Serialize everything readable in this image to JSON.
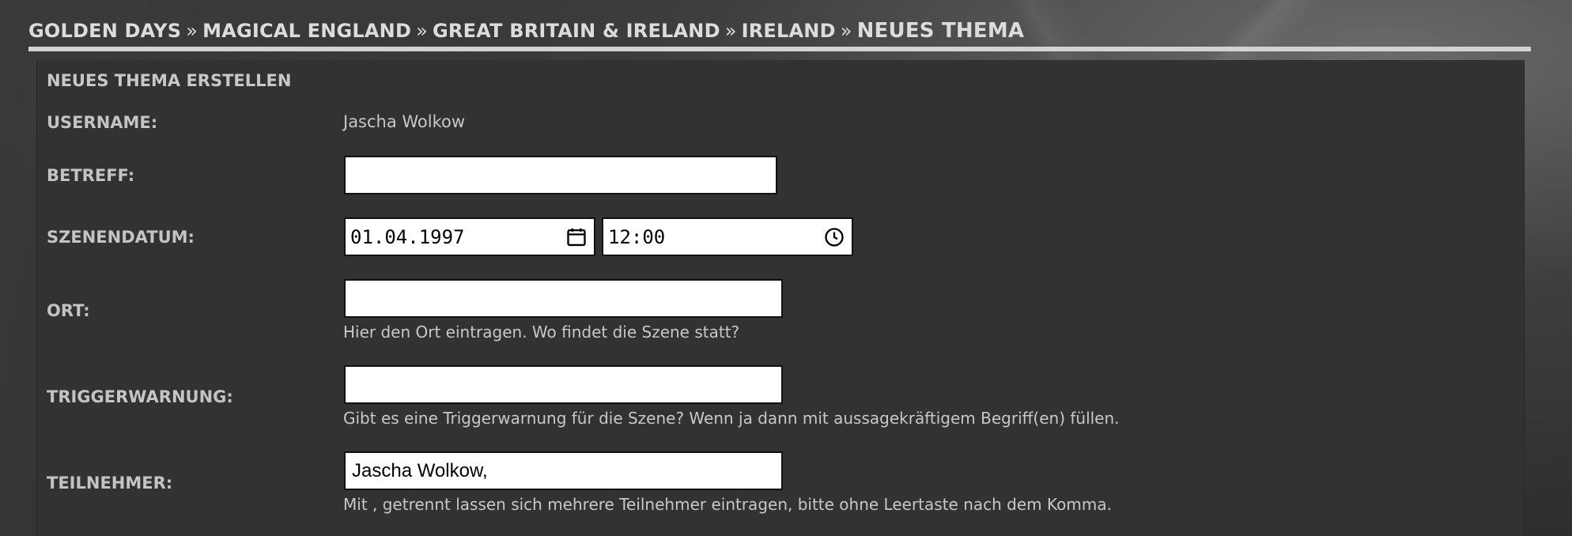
{
  "breadcrumb": {
    "items": [
      "GOLDEN DAYS",
      "MAGICAL ENGLAND",
      "GREAT BRITAIN & IRELAND",
      "IRELAND",
      "NEUES THEMA"
    ],
    "separator": "»"
  },
  "form": {
    "title": "NEUES THEMA ERSTELLEN",
    "username_label": "USERNAME:",
    "username_value": "Jascha Wolkow",
    "subject_label": "BETREFF:",
    "subject_value": "",
    "scene_date_label": "SZENENDATUM:",
    "scene_date_value": "01.04.1997",
    "scene_time_value": "12:00",
    "location_label": "ORT:",
    "location_value": "",
    "location_hint": "Hier den Ort eintragen. Wo findet die Szene statt?",
    "trigger_label": "TRIGGERWARNUNG:",
    "trigger_value": "",
    "trigger_hint": "Gibt es eine Triggerwarnung für die Szene? Wenn ja dann mit aussagekräftigem Begriff(en) füllen.",
    "participants_label": "TEILNEHMER:",
    "participants_value": "Jascha Wolkow,",
    "participants_hint": "Mit , getrennt lassen sich mehrere Teilnehmer eintragen, bitte ohne Leertaste nach dem Komma."
  },
  "icons": {
    "calendar": "calendar-icon",
    "clock": "clock-icon"
  },
  "colors": {
    "panel": "#323232",
    "divider": "#d3d3d3",
    "label": "#c4c4c4"
  }
}
